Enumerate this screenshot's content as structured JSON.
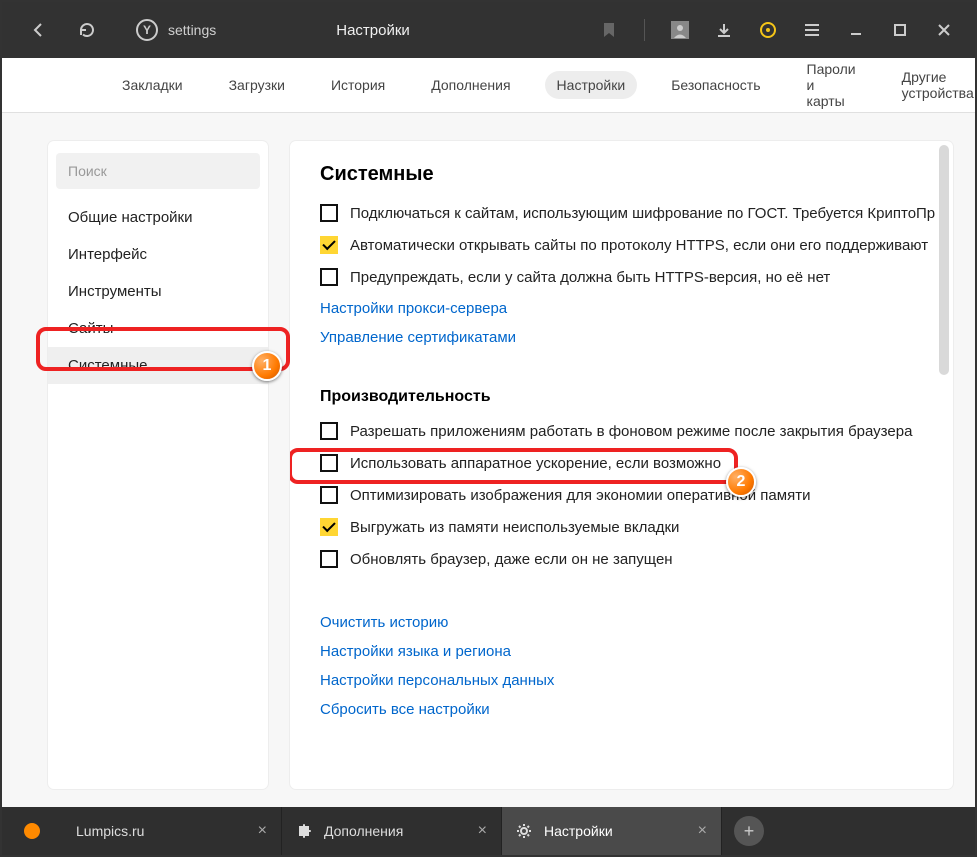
{
  "topbar": {
    "address": "settings",
    "page_title": "Настройки"
  },
  "toptabs": [
    "Закладки",
    "Загрузки",
    "История",
    "Дополнения",
    "Настройки",
    "Безопасность",
    "Пароли и карты",
    "Другие устройства"
  ],
  "toptabs_active_index": 4,
  "sidebar": {
    "search_placeholder": "Поиск",
    "items": [
      "Общие настройки",
      "Интерфейс",
      "Инструменты",
      "Сайты",
      "Системные"
    ],
    "active_index": 4
  },
  "main": {
    "section1_title": "Системные",
    "sys_opts": [
      {
        "checked": false,
        "label": "Подключаться к сайтам, использующим шифрование по ГОСТ. Требуется КриптоПр"
      },
      {
        "checked": true,
        "label": "Автоматически открывать сайты по протоколу HTTPS, если они его поддерживают"
      },
      {
        "checked": false,
        "label": "Предупреждать, если у сайта должна быть HTTPS-версия, но её нет"
      }
    ],
    "sys_links": [
      "Настройки прокси-сервера",
      "Управление сертификатами"
    ],
    "section2_title": "Производительность",
    "perf_opts": [
      {
        "checked": false,
        "label": "Разрешать приложениям работать в фоновом режиме после закрытия браузера"
      },
      {
        "checked": false,
        "label": "Использовать аппаратное ускорение, если возможно"
      },
      {
        "checked": false,
        "label": "Оптимизировать изображения для экономии оперативной памяти"
      },
      {
        "checked": true,
        "label": "Выгружать из памяти неиспользуемые вкладки"
      },
      {
        "checked": false,
        "label": "Обновлять браузер, даже если он не запущен"
      }
    ],
    "bottom_links": [
      "Очистить историю",
      "Настройки языка и региона",
      "Настройки персональных данных",
      "Сбросить все настройки"
    ]
  },
  "callouts": {
    "badge1": "1",
    "badge2": "2"
  },
  "tabbar": {
    "tabs": [
      {
        "label": "Lumpics.ru",
        "icon": "dot"
      },
      {
        "label": "Дополнения",
        "icon": "puzzle"
      },
      {
        "label": "Настройки",
        "icon": "gear",
        "active": true
      }
    ]
  }
}
